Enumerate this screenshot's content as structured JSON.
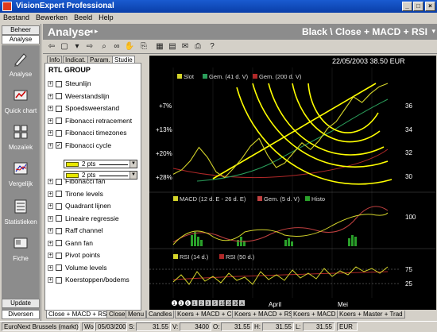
{
  "window": {
    "title": "VisionExpert Professional",
    "buttons": {
      "min": "_",
      "max": "□",
      "close": "×"
    }
  },
  "menu": [
    "Bestand",
    "Bewerken",
    "Beeld",
    "Help"
  ],
  "nav": {
    "top_buttons": [
      "Beheer",
      "Analyse"
    ],
    "items": [
      "Analyse",
      "Quick chart",
      "Mozaïek",
      "Vergelijk",
      "Statistieken",
      "Fiche"
    ],
    "bottom_buttons": [
      "Update",
      "Diversen"
    ]
  },
  "header": {
    "section": "Analyse",
    "chart_title": "Black \\ Close + MACD + RSI"
  },
  "panel": {
    "tabs": [
      "Info",
      "Indicat.",
      "Param.",
      "Studie"
    ],
    "group": "RTL GROUP",
    "studies": [
      {
        "label": "Steunlijn",
        "checked": false
      },
      {
        "label": "Weerstandslijn",
        "checked": false
      },
      {
        "label": "Spoedsweerstand",
        "checked": false
      },
      {
        "label": "Fibonacci retracement",
        "checked": false
      },
      {
        "label": "Fibonacci timezones",
        "checked": false
      },
      {
        "label": "Fibonacci cycle",
        "checked": true
      },
      {
        "label": "Fibonacci fan",
        "checked": false
      },
      {
        "label": "Tirone levels",
        "checked": false
      },
      {
        "label": "Quadrant lijnen",
        "checked": false
      },
      {
        "label": "Lineaire regressie",
        "checked": false
      },
      {
        "label": "Raff channel",
        "checked": false
      },
      {
        "label": "Gann fan",
        "checked": false
      },
      {
        "label": "Pivot points",
        "checked": false
      },
      {
        "label": "Volume levels",
        "checked": false
      },
      {
        "label": "Koerstoppen/bodems",
        "checked": false
      }
    ],
    "dropdowns": [
      "2 pts",
      "2 pts"
    ],
    "check_mark": "✓"
  },
  "chart": {
    "info": "22/05/2003 38.50 EUR",
    "price_legend": [
      "Slot",
      "Gem. (41 d. V)",
      "Gem. (200 d. V)"
    ],
    "macd_legend": [
      "MACD (12 d. E - 26 d. E)",
      "Gem. (5 d. V)",
      "Histo"
    ],
    "rsi_legend": [
      "RSI (14 d.)",
      "RSI (50 d.)"
    ],
    "pct_labels": [
      "+7%",
      "+13%",
      "+20%",
      "+28%"
    ],
    "price_axis": [
      "36",
      "34",
      "32",
      "30"
    ],
    "macd_axis": [
      "100"
    ],
    "rsi_axis": [
      "75",
      "25"
    ],
    "time_labels": [
      "April",
      "Mei"
    ],
    "nav_buttons": [
      "1",
      "3",
      "6",
      "1",
      "2",
      "3",
      "5",
      "10",
      "20",
      "30",
      "A"
    ],
    "colors": {
      "close": "#d4d42a",
      "avg41": "#2a9d5a",
      "avg200": "#b02828",
      "fib": "#ffff00",
      "macd": "#d4d42a",
      "macd_avg": "#c04040",
      "histo": "#2aa02a",
      "rsi": "#d4d42a",
      "rsi50": "#b02828"
    }
  },
  "chart_data": {
    "type": "line",
    "series": [
      {
        "name": "Slot",
        "values": [
          30.4,
          30.8,
          31.6,
          32.8,
          31.9,
          30.6,
          30.1,
          30.9,
          31.8,
          32.9,
          33.6,
          32.1,
          31.0,
          31.4,
          32.3,
          33.2,
          32.6,
          33.4,
          34.5,
          35.1,
          36.2,
          37.3,
          36.8,
          37.6,
          38.2,
          38.5
        ]
      }
    ]
  },
  "bottom_tabs": [
    "Close + MACD + RSI",
    "Close",
    "Menu",
    "Candles",
    "Koers + MACD + CCI",
    "Koers + MACD + RSI",
    "Koers + MACD",
    "Koers + Master + Trad"
  ],
  "status": {
    "market": "EuroNext Brussels (markt)",
    "day": "Wo",
    "date": "05/03/2003",
    "s_label": "S:",
    "s_value": "31.55",
    "v_label": "V:",
    "v_value": "3400",
    "o_label": "O:",
    "o_value": "31.55",
    "h_label": "H:",
    "h_value": "31.55",
    "l_label": "L:",
    "l_value": "31.55",
    "currency": "EUR"
  }
}
